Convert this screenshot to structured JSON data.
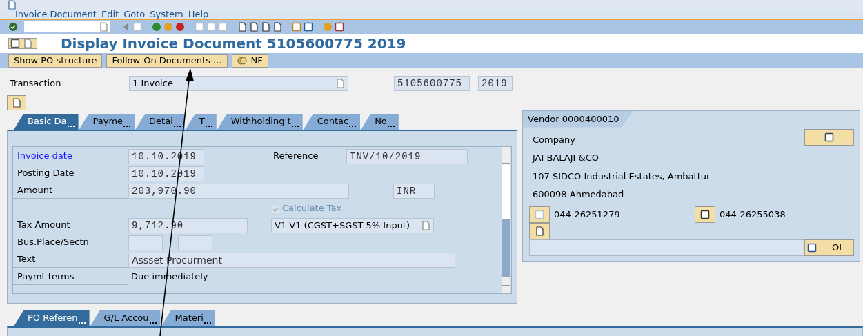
{
  "menu_bar": [
    "Invoice Document",
    "Edit",
    "Goto",
    "System",
    "Help"
  ],
  "title": "Display Invoice Document 5105600775 2019",
  "app_toolbar": [
    {
      "label": "Show PO structure",
      "kind": "text"
    },
    {
      "label": "Follow-On Documents ...",
      "kind": "text"
    },
    {
      "label": "NF",
      "kind": "icon"
    }
  ],
  "transaction": {
    "label": "Transaction",
    "value": "1 Invoice",
    "document_number": "5105600775",
    "fiscal_year": "2019"
  },
  "tabs": [
    {
      "label": "Basic Da",
      "selected": true,
      "truncated": true
    },
    {
      "label": "Payme",
      "selected": false,
      "truncated": true
    },
    {
      "label": "Detai",
      "selected": false,
      "truncated": true
    },
    {
      "label": "T",
      "selected": false,
      "truncated": true
    },
    {
      "label": "Withholding t",
      "selected": false,
      "truncated": true
    },
    {
      "label": "Contac",
      "selected": false,
      "truncated": true
    },
    {
      "label": "No",
      "selected": false,
      "truncated": true
    }
  ],
  "basic_data": {
    "invoice_date": {
      "label": "Invoice date",
      "value": "10.10.2019",
      "emphasized": true
    },
    "reference": {
      "label": "Reference",
      "value": "INV/10/2019"
    },
    "posting_date": {
      "label": "Posting Date",
      "value": "10.10.2019",
      "emphasized": false
    },
    "amount": {
      "label": "Amount",
      "value": "203,970.90",
      "currency": "INR",
      "emphasized": false
    },
    "calculate_tax": {
      "label": "Calculate Tax",
      "checked": true,
      "disabled": true
    },
    "tax_amount": {
      "label": "Tax Amount",
      "value": "9,712.90",
      "tax_code": "V1 V1 (CGST+SGST 5% Input)",
      "emphasized": false
    },
    "bus_place": {
      "label": "Bus.Place/Sectn",
      "emphasized": false
    },
    "text": {
      "label": "Text",
      "value": "Assset Procurment",
      "emphasized": false
    },
    "payment_terms": {
      "label": "Paymt terms",
      "value": "Due immediately",
      "emphasized": false
    }
  },
  "vendor": {
    "title": "Vendor 0000400010",
    "lines": [
      "Company",
      "JAI BALAJI &CO",
      "107 SIDCO Industrial Estates, Ambattur",
      "600098 Ahmedabad"
    ],
    "phone": "044-26251279",
    "fax": "044-26255038",
    "oi_button": "OI"
  },
  "bottom_tabs": [
    {
      "label": "PO Referen",
      "selected": true,
      "truncated": true
    },
    {
      "label": "G/L Accou",
      "selected": false,
      "truncated": true
    },
    {
      "label": "Materi",
      "selected": false,
      "truncated": true
    }
  ]
}
